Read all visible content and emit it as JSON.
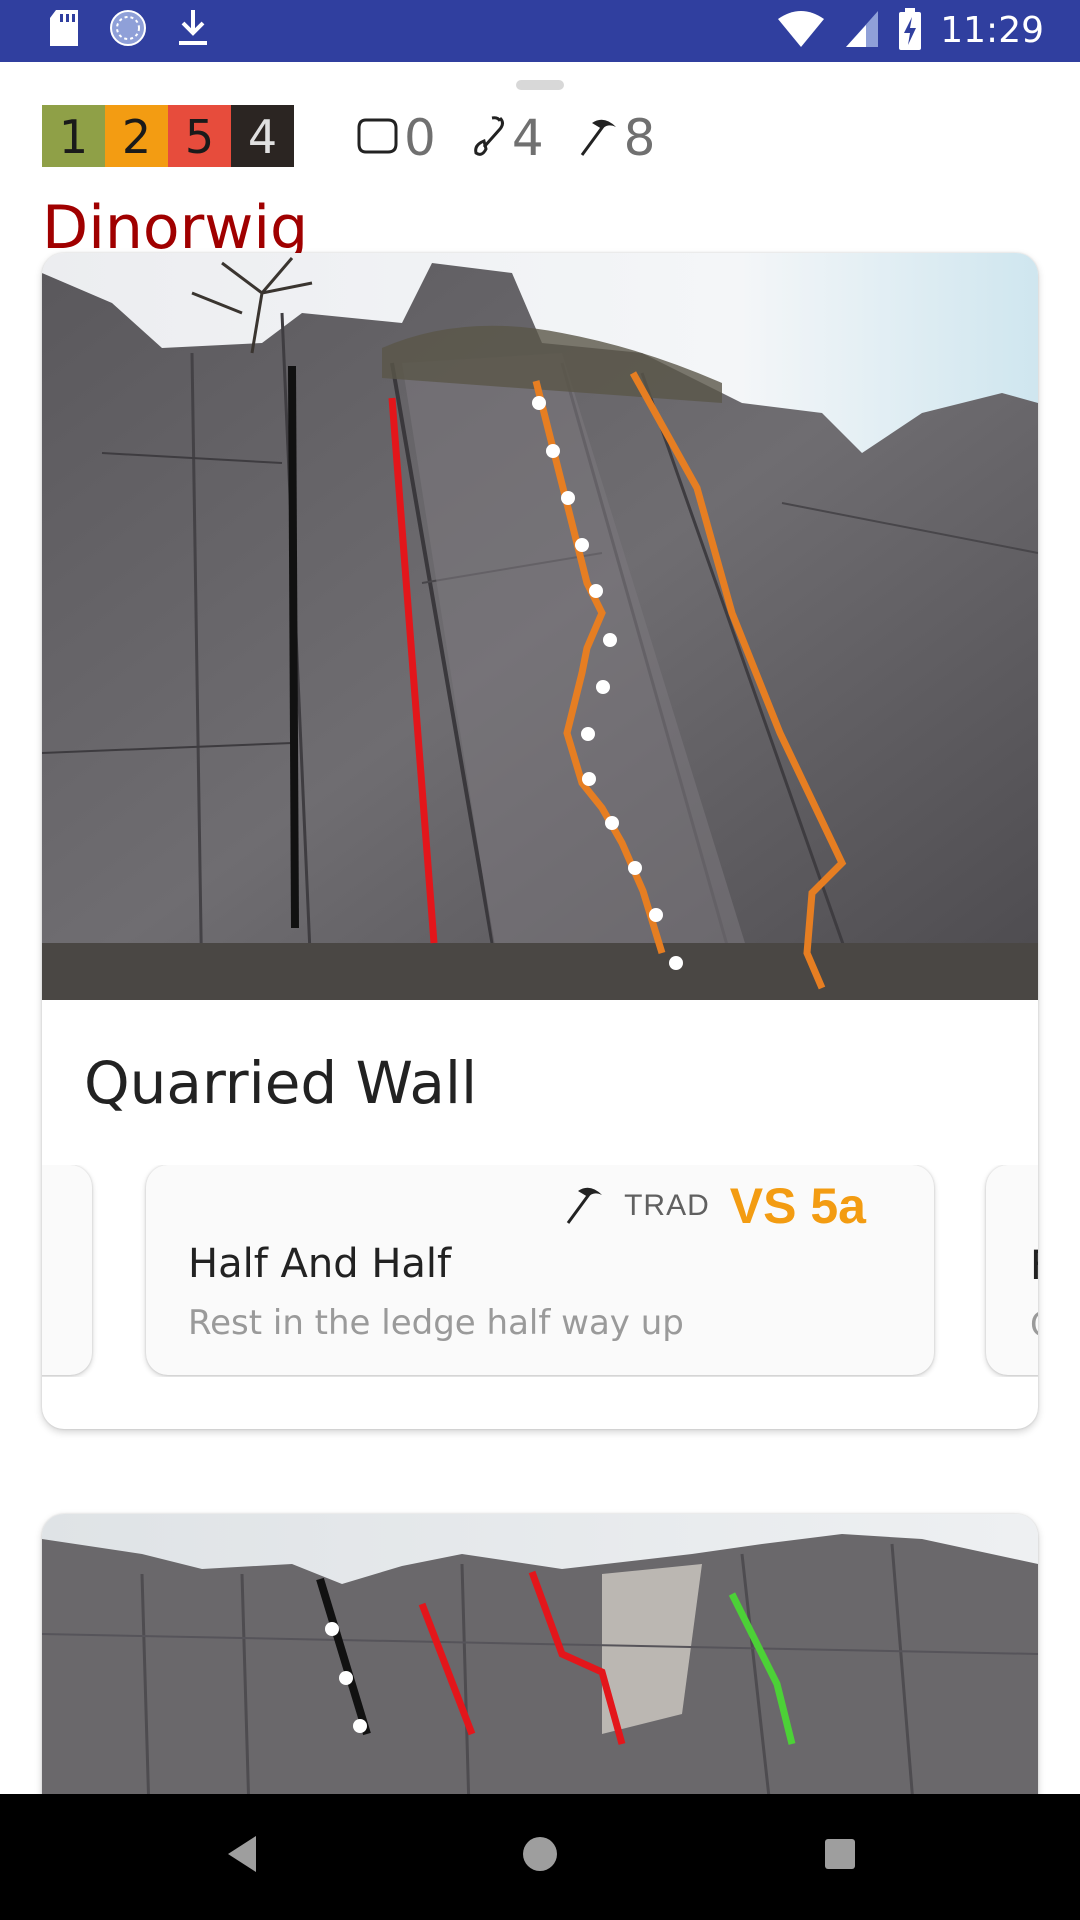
{
  "status_bar": {
    "time": "11:29",
    "left_icons": [
      "sd-card-icon",
      "sync-icon",
      "download-icon"
    ],
    "right_icons": [
      "wifi-icon",
      "cell-signal-icon",
      "battery-charging-icon"
    ],
    "color": "#303f9f"
  },
  "crag": {
    "title": "Dinorwig",
    "title_color": "#a00000",
    "grade_counts": [
      {
        "value": "1",
        "bg": "#8fa047",
        "fg": "#1a1a1a"
      },
      {
        "value": "2",
        "bg": "#f39c12",
        "fg": "#1a1a1a"
      },
      {
        "value": "5",
        "bg": "#e74c3c",
        "fg": "#1a1a1a"
      },
      {
        "value": "4",
        "bg": "#2b2522",
        "fg": "#e0e0e0"
      }
    ],
    "style_counts": {
      "boulder": "0",
      "sport": "4",
      "trad": "8"
    }
  },
  "sectors": [
    {
      "title": "Quarried Wall",
      "routes": {
        "current": {
          "style": "TRAD",
          "grade": "VS 5a",
          "grade_color": "#f39c12",
          "name": "Half And Half",
          "description": "Rest in the ledge half way up"
        },
        "next_peek": {
          "name": "F",
          "description": "C"
        }
      }
    },
    {
      "title": ""
    }
  ],
  "route_line_colors": {
    "black": "#111111",
    "red": "#e3161b",
    "orange": "#e67e22",
    "green": "#4cd137",
    "white": "#ffffff"
  }
}
